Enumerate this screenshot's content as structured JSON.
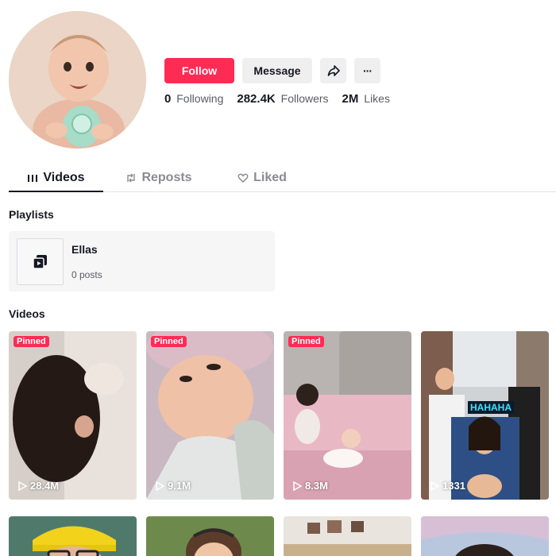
{
  "profile": {
    "avatar_alt": "baby-avatar"
  },
  "actions": {
    "follow_label": "Follow",
    "message_label": "Message",
    "share_icon": "share-arrow-icon",
    "more_icon": "more-dots-icon",
    "more_label": "···"
  },
  "stats": {
    "following_count": "0",
    "following_label": "Following",
    "followers_count": "282.4K",
    "followers_label": "Followers",
    "likes_count": "2M",
    "likes_label": "Likes"
  },
  "tabs": [
    {
      "label": "Videos",
      "icon": "grid-icon",
      "active": true
    },
    {
      "label": "Reposts",
      "icon": "repost-icon",
      "active": false
    },
    {
      "label": "Liked",
      "icon": "heart-icon",
      "active": false
    }
  ],
  "playlists": {
    "title": "Playlists",
    "items": [
      {
        "name": "Ellas",
        "count": "0 posts"
      }
    ]
  },
  "videos": {
    "title": "Videos",
    "pinned_label": "Pinned",
    "items": [
      {
        "views": "28.4M",
        "pinned": true
      },
      {
        "views": "9.1M",
        "pinned": true
      },
      {
        "views": "8.3M",
        "pinned": true
      },
      {
        "views": "1331",
        "pinned": false,
        "overlay_text": "HAHAHA"
      }
    ]
  },
  "colors": {
    "accent": "#fe2c55",
    "button_gray": "#efefef",
    "text_primary": "#161823",
    "text_secondary": "#5a5b63"
  }
}
